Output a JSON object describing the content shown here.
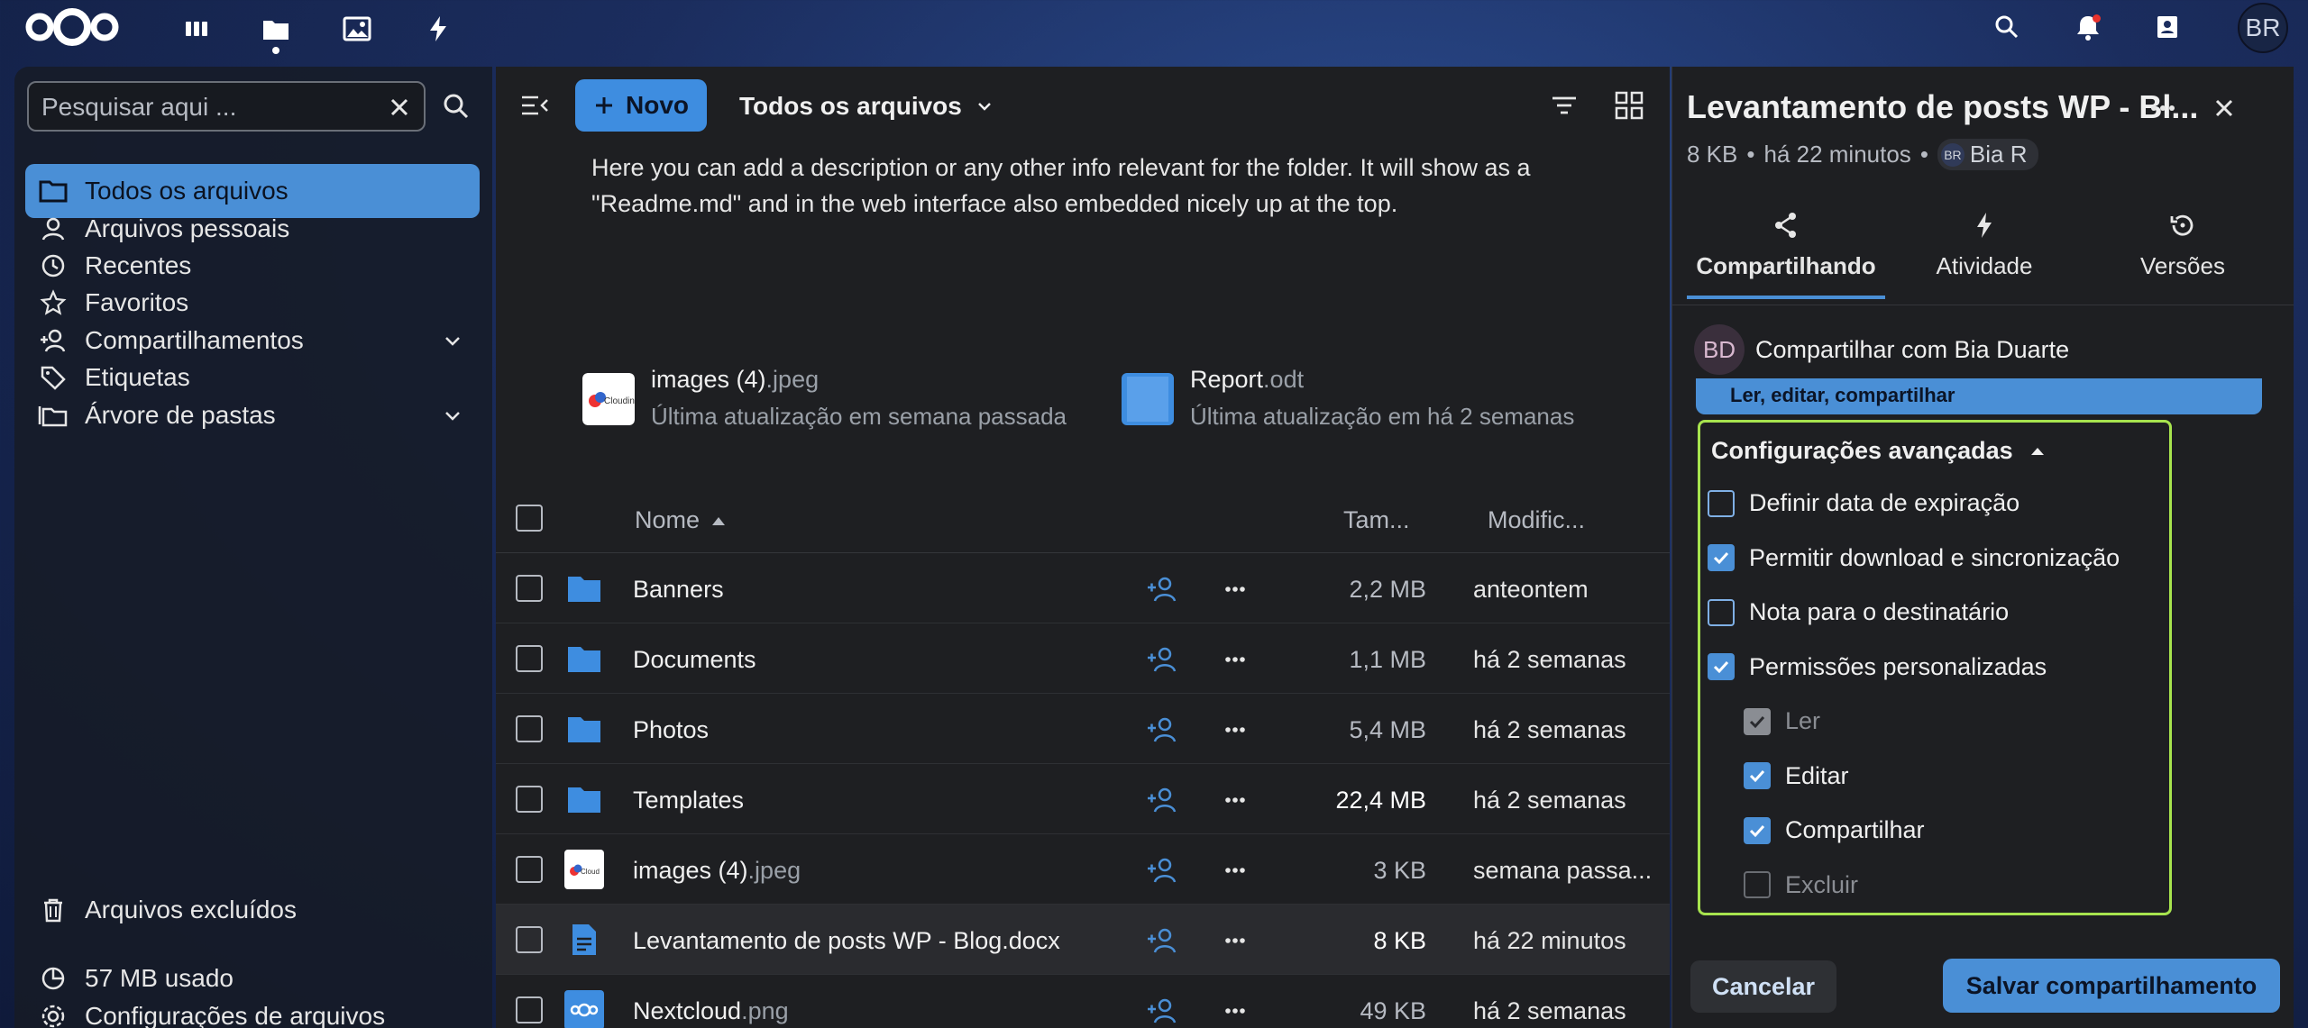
{
  "topbar": {
    "apps": [
      "dashboard-icon",
      "files-icon",
      "photos-icon",
      "activity-icon"
    ],
    "avatar_initials": "BR"
  },
  "leftnav": {
    "search_placeholder": "Pesquisar aqui ...",
    "items": [
      {
        "label": "Todos os arquivos",
        "icon": "folder-icon",
        "active": true
      },
      {
        "label": "Arquivos pessoais",
        "icon": "user-icon"
      },
      {
        "label": "Recentes",
        "icon": "history-icon"
      },
      {
        "label": "Favoritos",
        "icon": "star-icon"
      },
      {
        "label": "Compartilhamentos",
        "icon": "share-icon",
        "expandable": true
      },
      {
        "label": "Etiquetas",
        "icon": "tag-icon"
      },
      {
        "label": "Árvore de pastas",
        "icon": "folder-tree-icon",
        "expandable": true
      }
    ],
    "bottom": {
      "deleted": "Arquivos excluídos",
      "usage": "57 MB usado",
      "settings": "Configurações de arquivos"
    }
  },
  "main": {
    "new_label": "Novo",
    "breadcrumb": "Todos os arquivos",
    "readme_line1": "Here you can add a description or any other info relevant for the folder. It will show as a",
    "readme_line2": "\"Readme.md\" and in the web interface also embedded nicely up at the top.",
    "recent": [
      {
        "name": "images (4)",
        "ext": ".jpeg",
        "sub": "Última atualização em semana passada"
      },
      {
        "name": "Report",
        "ext": ".odt",
        "sub": "Última atualização em há 2 semanas"
      }
    ],
    "columns": {
      "name": "Nome",
      "size": "Tam...",
      "modified": "Modific..."
    },
    "rows": [
      {
        "name": "Banners",
        "ext": "",
        "size": "2,2 MB",
        "modified": "anteontem",
        "type": "folder"
      },
      {
        "name": "Documents",
        "ext": "",
        "size": "1,1 MB",
        "modified": "há 2 semanas",
        "type": "folder"
      },
      {
        "name": "Photos",
        "ext": "",
        "size": "5,4 MB",
        "modified": "há 2 semanas",
        "type": "folder"
      },
      {
        "name": "Templates",
        "ext": "",
        "size": "22,4 MB",
        "modified": "há 2 semanas",
        "type": "folder"
      },
      {
        "name": "images (4)",
        "ext": ".jpeg",
        "size": "3 KB",
        "modified": "semana passa...",
        "type": "image"
      },
      {
        "name": "Levantamento de posts WP - Blog.docx",
        "ext": "",
        "size": "8 KB",
        "modified": "há 22 minutos",
        "type": "doc"
      },
      {
        "name": "Nextcloud",
        "ext": ".png",
        "size": "49 KB",
        "modified": "há 2 semanas",
        "type": "nextcloud"
      }
    ]
  },
  "sidebar": {
    "title": "Levantamento de posts WP - Bl...",
    "size": "8 KB",
    "modified": "há 22 minutos",
    "owner_initials": "BR",
    "owner_name": "Bia R",
    "tabs": [
      "Compartilhando",
      "Atividade",
      "Versões"
    ],
    "share_initials": "BD",
    "share_with": "Compartilhar com Bia Duarte",
    "permission_summary": "Ler, editar, compartilhar",
    "advanced_title": "Configurações avançadas",
    "options": [
      {
        "label": "Definir data de expiração",
        "checked": false
      },
      {
        "label": "Permitir download e sincronização",
        "checked": true
      },
      {
        "label": "Nota para o destinatário",
        "checked": false
      },
      {
        "label": "Permissões personalizadas",
        "checked": true
      }
    ],
    "perms": [
      {
        "label": "Ler",
        "checked": true,
        "disabled": true
      },
      {
        "label": "Editar",
        "checked": true
      },
      {
        "label": "Compartilhar",
        "checked": true
      },
      {
        "label": "Excluir",
        "checked": false,
        "disabled": true
      }
    ],
    "cancel": "Cancelar",
    "save": "Salvar compartilhamento"
  },
  "colors": {
    "accent": "#4a8fd6",
    "highlight_border": "#a7e34e",
    "background": "#1e1f22"
  }
}
